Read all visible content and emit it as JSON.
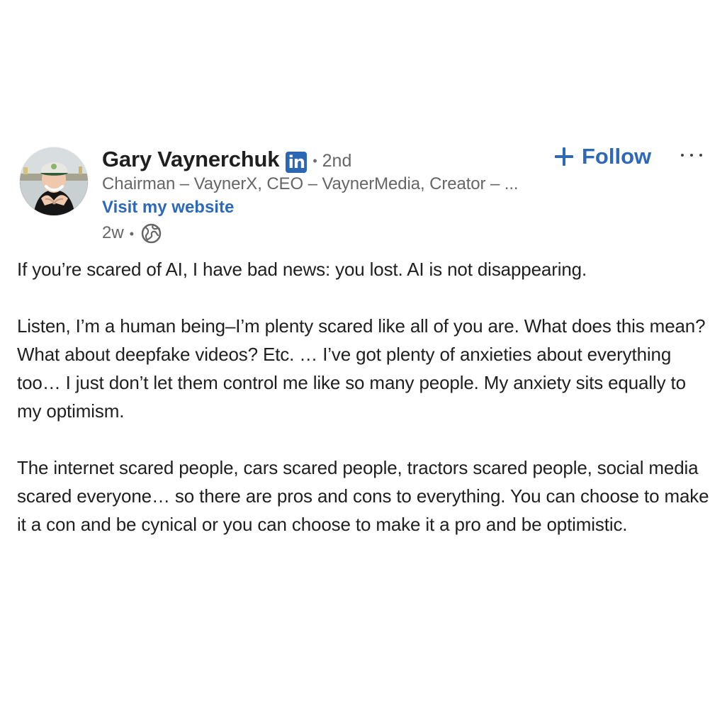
{
  "post": {
    "author": {
      "name": "Gary Vaynerchuk",
      "badge_label": "in",
      "connection_degree": "2nd",
      "headline": "Chairman – VaynerX, CEO – VaynerMedia, Creator – ...",
      "website_label": "Visit my website",
      "posted_time": "2w",
      "visibility_icon": "globe-icon"
    },
    "actions": {
      "follow_label": "Follow",
      "more_icon": "more-options-icon"
    },
    "body": {
      "paragraphs": [
        "If you’re scared of AI, I have bad news: you lost. AI is not disappearing.",
        "Listen, I’m a human being–I’m plenty scared like all of you are. What does this mean? What about deepfake videos? Etc. … I’ve got plenty of anxieties about everything too… I just don’t let them control me like so many people. My anxiety sits equally to my optimism.",
        "The internet scared people, cars scared people, tractors scared people, social media scared everyone… so there are pros and cons to everything. You can choose to make it a con and be cynical or you can choose to make it a pro and be optimistic."
      ]
    },
    "colors": {
      "link_blue": "#2d68b9",
      "badge_blue": "#2b67b3",
      "muted_text": "#666666",
      "body_text": "#1f1f1f"
    }
  }
}
